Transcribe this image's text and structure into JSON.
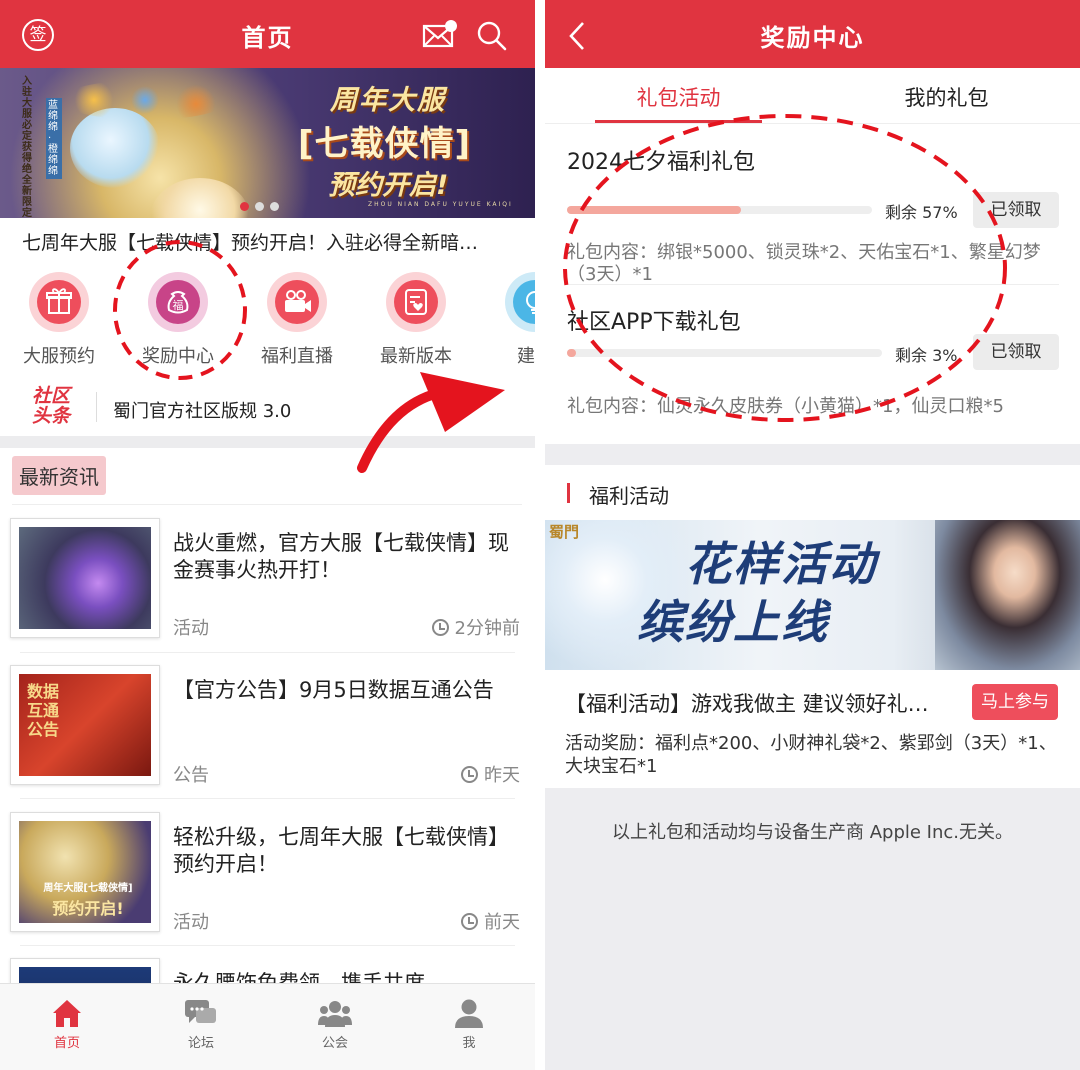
{
  "left": {
    "header": {
      "title": "首页",
      "sign_label": "签"
    },
    "banner": {
      "line1": "周年大服",
      "line2": "[七载侠情]",
      "line3": "预约开启!",
      "line4": "ZHOU NIAN DAFU YUYUE KAIQI",
      "side_text_1": "入驻大服必定获得绝全新限定坐骑",
      "side_text_2": "蓝绵绵·橙绵绵"
    },
    "headline": "七周年大服【七载侠情】预约开启！入驻必得全新暗…",
    "quick_icons": [
      {
        "label": "大服预约",
        "icon": "gift-box-icon"
      },
      {
        "label": "奖励中心",
        "icon": "lucky-bag-icon",
        "icon_text": "福"
      },
      {
        "label": "福利直播",
        "icon": "video-camera-icon"
      },
      {
        "label": "最新版本",
        "icon": "heart-document-icon"
      },
      {
        "label": "建议",
        "icon": "lightbulb-icon"
      }
    ],
    "toutiao": {
      "logo": "社区头条",
      "text": "蜀门官方社区版规 3.0"
    },
    "section_title": "最新资讯",
    "news": [
      {
        "title": "战火重燃，官方大服【七载侠情】现金赛事火热开打！",
        "category": "活动",
        "time": "2分钟前"
      },
      {
        "title": "【官方公告】9月5日数据互通公告",
        "category": "公告",
        "time": "昨天",
        "thumb_text": "数据互通公告"
      },
      {
        "title": "轻松升级，七周年大服【七载侠情】预约开启！",
        "category": "活动",
        "time": "前天",
        "thumb_text_1": "周年大服[七载侠情]",
        "thumb_text_2": "预约开启!"
      },
      {
        "title": "永久腰饰免费领，携手共度",
        "category": "",
        "time": ""
      }
    ],
    "tabbar": [
      {
        "label": "首页",
        "active": true,
        "icon": "home-icon"
      },
      {
        "label": "论坛",
        "active": false,
        "icon": "chat-bubbles-icon"
      },
      {
        "label": "公会",
        "active": false,
        "icon": "group-icon"
      },
      {
        "label": "我",
        "active": false,
        "icon": "person-icon"
      }
    ]
  },
  "right": {
    "header": {
      "title": "奖励中心"
    },
    "tabs": [
      {
        "label": "礼包活动",
        "active": true
      },
      {
        "label": "我的礼包",
        "active": false
      }
    ],
    "gifts": [
      {
        "title": "2024七夕福利礼包",
        "remaining_label": "剩余 57%",
        "remaining_pct": 57,
        "status": "已领取",
        "content": "礼包内容：绑银*5000、锁灵珠*2、天佑宝石*1、繁星幻梦（3天）*1"
      },
      {
        "title": "社区APP下载礼包",
        "remaining_label": "剩余 3%",
        "remaining_pct": 3,
        "status": "已领取",
        "content": "礼包内容：仙灵永久皮肤券（小黄猫）*1，仙灵口粮*5"
      }
    ],
    "welfare": {
      "section_title": "福利活动",
      "banner_line1": "花样活动",
      "banner_line2": "缤纷上线",
      "banner_logo": "蜀門",
      "title": "【福利活动】游戏我做主 建议领好礼…",
      "join_label": "马上参与",
      "reward": "活动奖励：福利点*200、小财神礼袋*2、紫郢剑（3天）*1、大块宝石*1"
    },
    "disclaimer": "以上礼包和活动均与设备生产商 Apple Inc.无关。"
  },
  "colors": {
    "brand_red": "#e03440",
    "light_pink": "#fbd3d6",
    "progress_fill": "#f4a79d",
    "tab_inactive": "#666666"
  }
}
